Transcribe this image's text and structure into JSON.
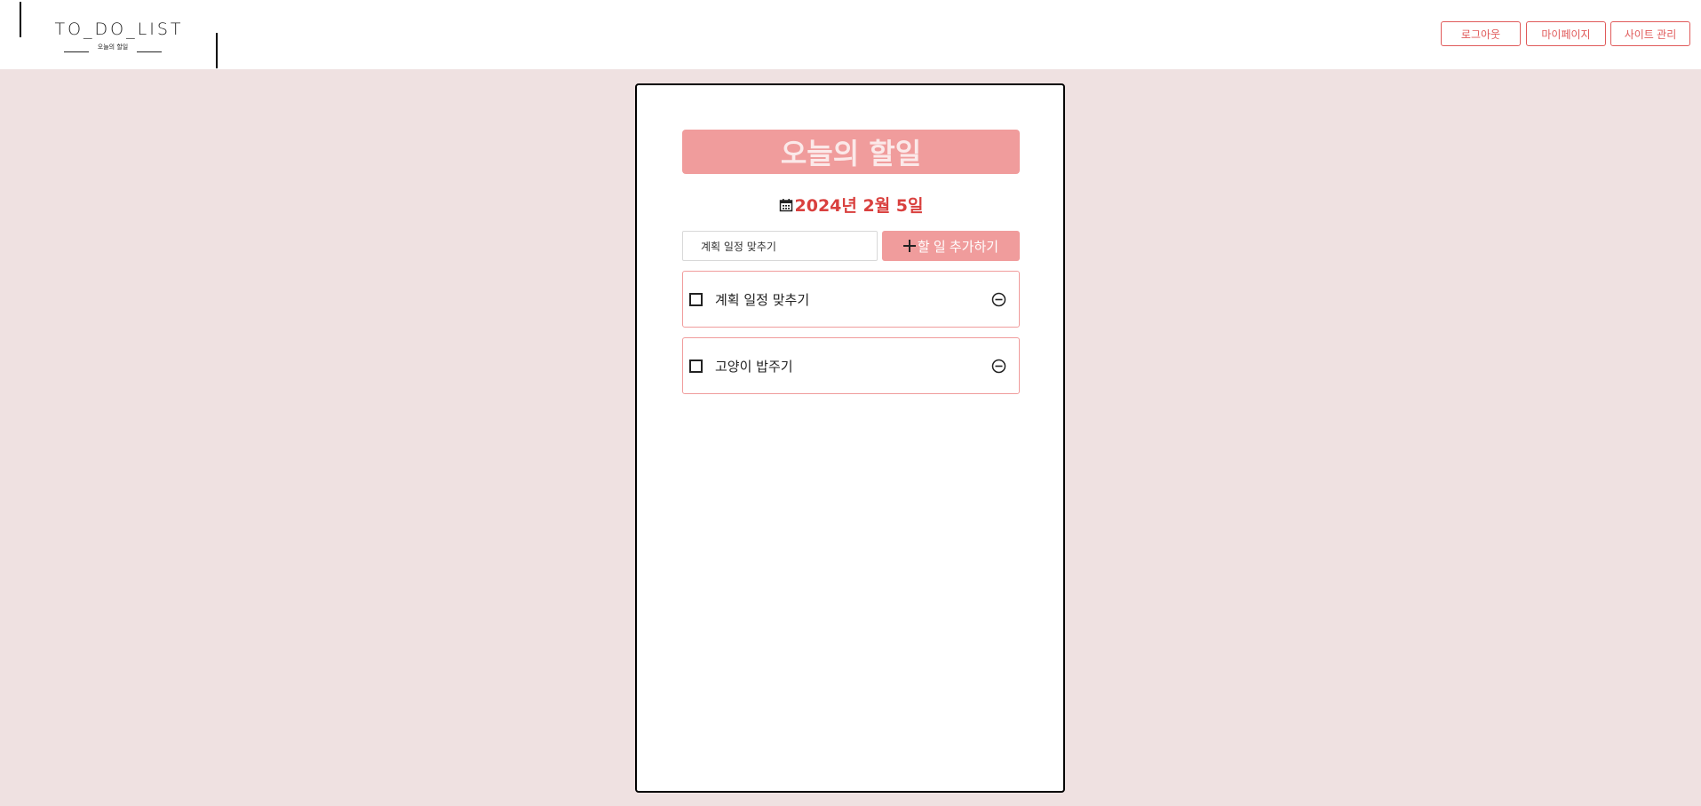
{
  "header": {
    "logo_title": "TO_DO_LIST",
    "logo_subtitle": "오늘의 할일",
    "buttons": {
      "logout": "로그아웃",
      "mypage": "마이페이지",
      "admin": "사이트 관리"
    }
  },
  "main": {
    "title": "오늘의 할일",
    "date": "2024년 2월 5일",
    "date_icon": "calendar-icon",
    "input": {
      "value": "계획 일정 맞추기"
    },
    "add_button": {
      "label": "할 일 추가하기",
      "icon": "plus-icon"
    },
    "todos": [
      {
        "label": "계획 일정 맞추기",
        "checked": false,
        "remove_icon": "minus-circle-icon"
      },
      {
        "label": "고양이 밥주기",
        "checked": false,
        "remove_icon": "minus-circle-icon"
      }
    ]
  },
  "colors": {
    "background": "#efe1e1",
    "accent": "#e05a5a",
    "title_box": "#f09c9c",
    "date_text": "#d9403e"
  }
}
